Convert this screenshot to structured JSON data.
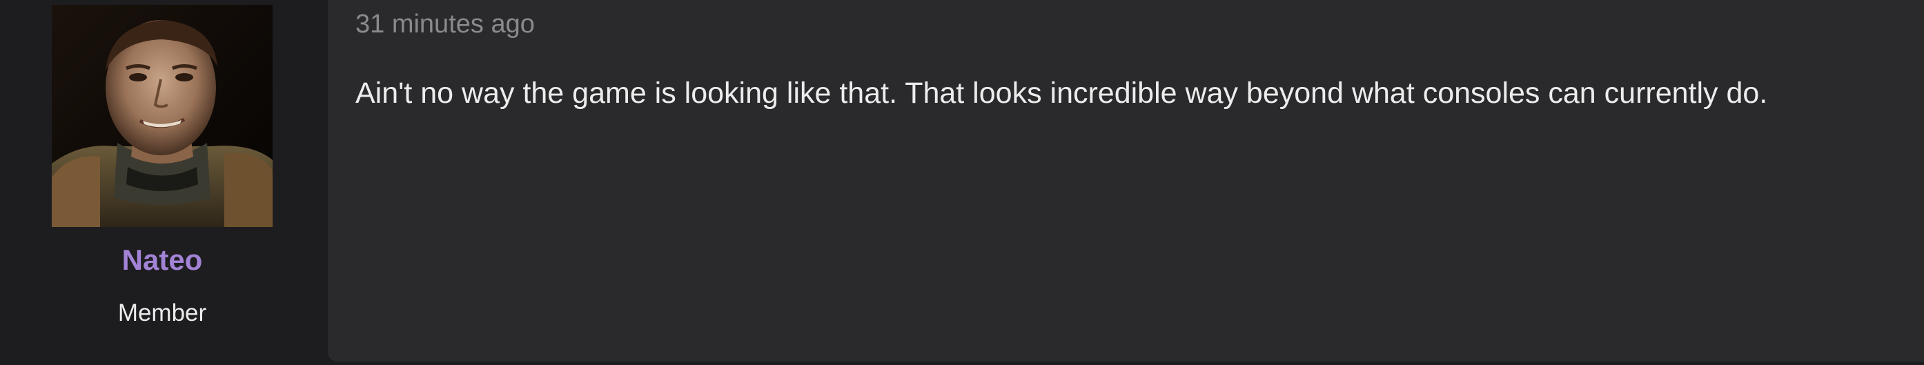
{
  "user": {
    "avatar_alt": "user-avatar",
    "name": "Nateo",
    "title": "Member"
  },
  "post": {
    "timestamp": "31 minutes ago",
    "body": "Ain't no way the game is looking like that. That looks incredible way beyond what consoles can currently do."
  },
  "colors": {
    "page_bg": "#1d1d1f",
    "message_bg": "#2a2a2d",
    "username": "#a283d6",
    "timestamp": "#8a8a8e",
    "text": "#ececec"
  }
}
